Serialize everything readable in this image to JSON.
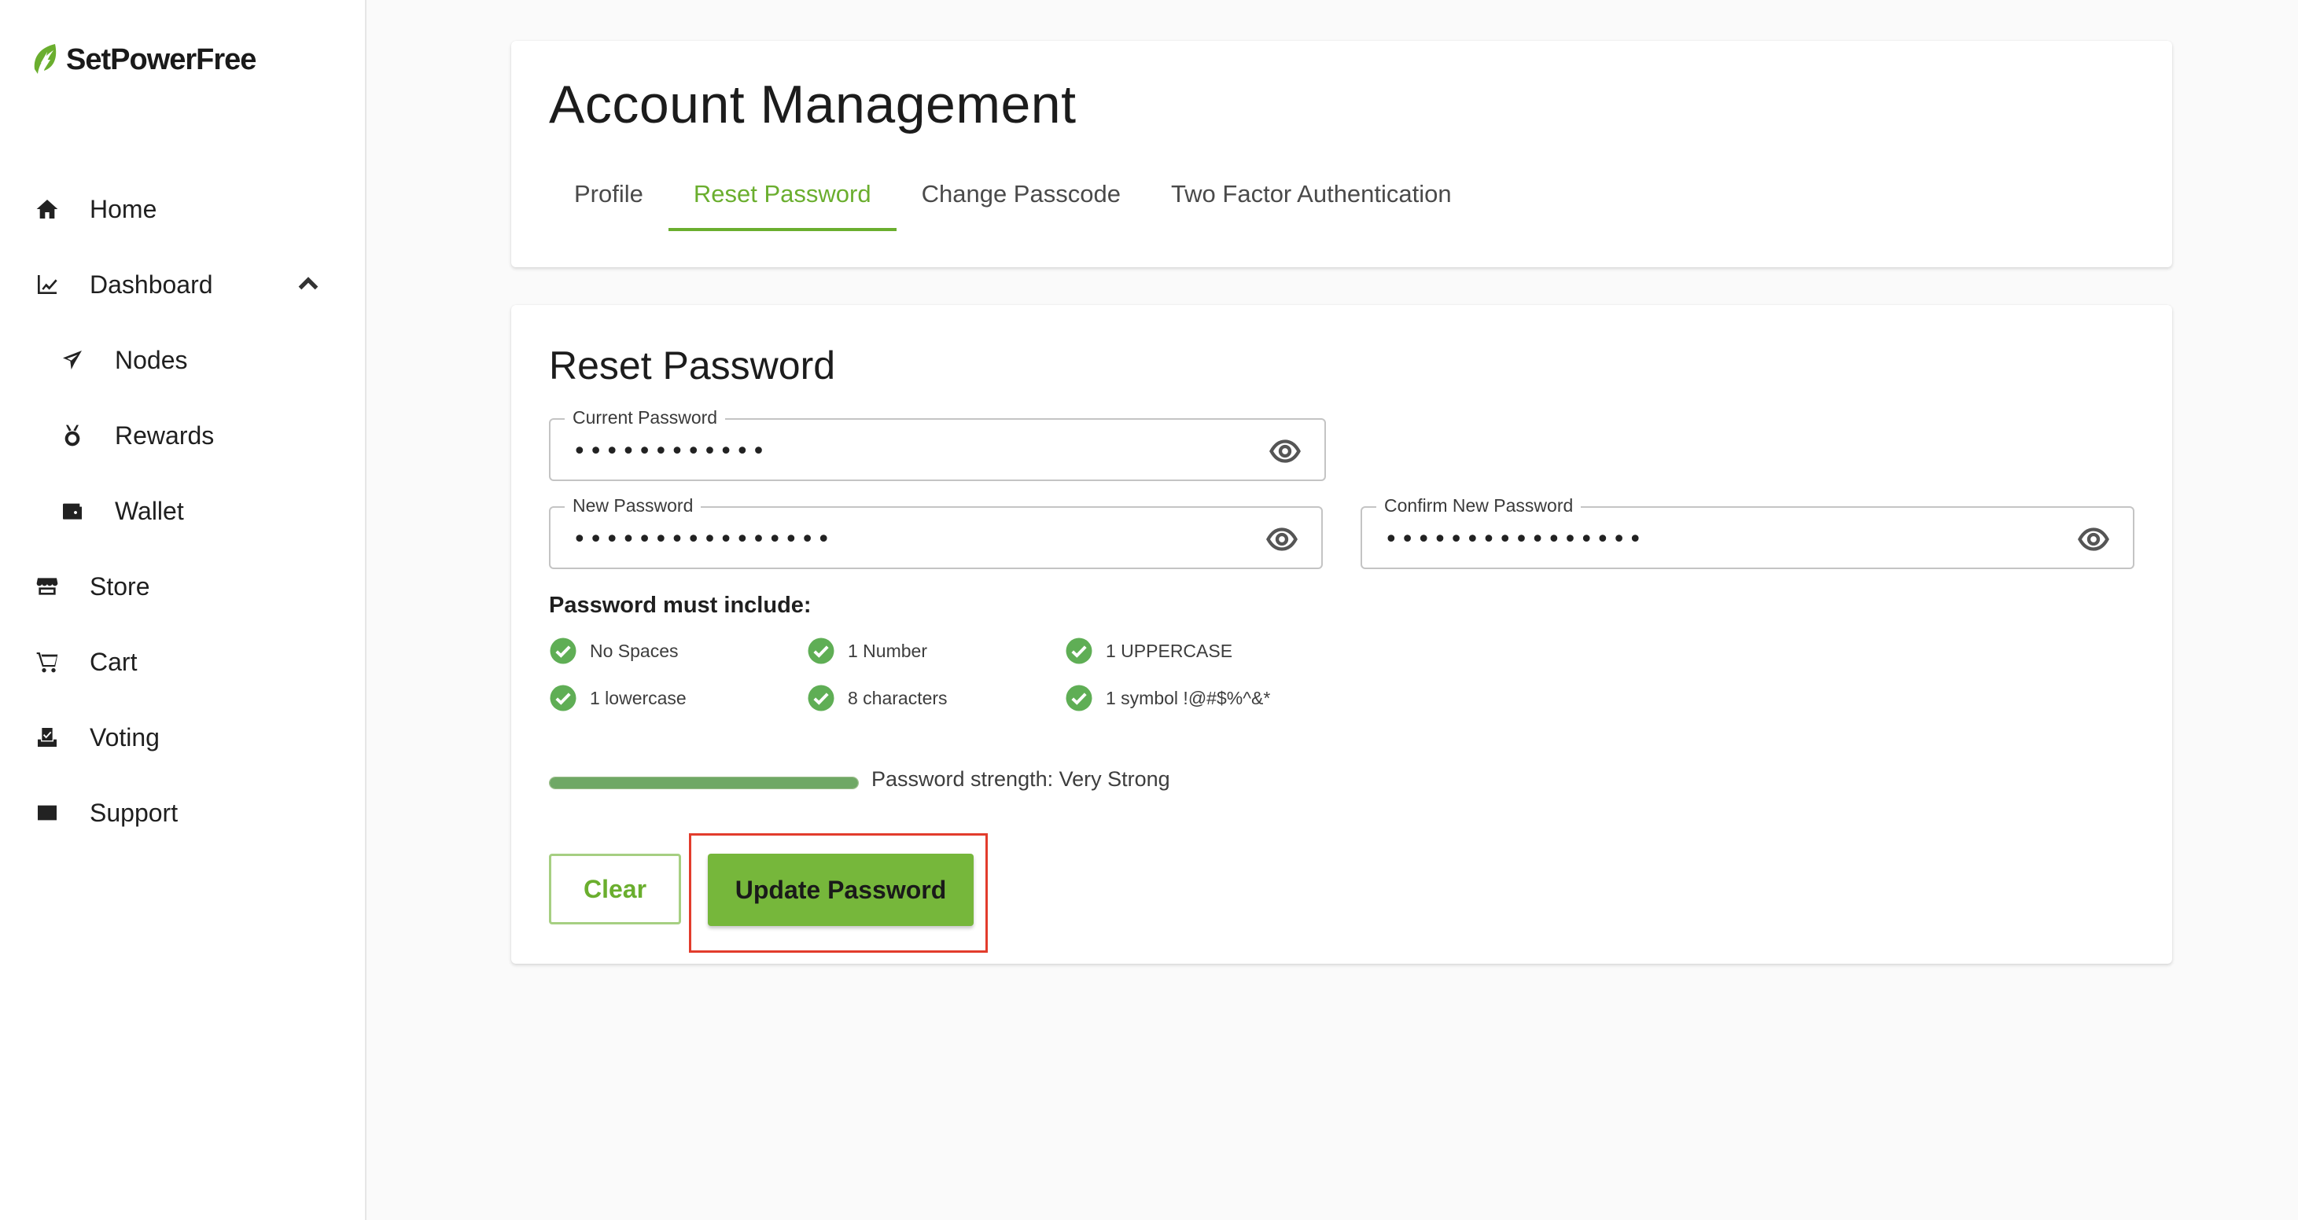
{
  "brand": {
    "name": "SetPowerFree",
    "accent": "#6aae2e"
  },
  "sidebar": {
    "items": [
      {
        "label": "Home",
        "icon": "home-icon"
      },
      {
        "label": "Dashboard",
        "icon": "chart-line-icon",
        "expanded": true
      },
      {
        "label": "Nodes",
        "icon": "nodes-icon",
        "sub": true
      },
      {
        "label": "Rewards",
        "icon": "medal-icon",
        "sub": true
      },
      {
        "label": "Wallet",
        "icon": "wallet-icon",
        "sub": true
      },
      {
        "label": "Store",
        "icon": "store-icon"
      },
      {
        "label": "Cart",
        "icon": "cart-icon"
      },
      {
        "label": "Voting",
        "icon": "ballot-icon"
      },
      {
        "label": "Support",
        "icon": "mail-icon"
      }
    ]
  },
  "header": {
    "title": "Account Management",
    "tabs": [
      {
        "label": "Profile",
        "active": false
      },
      {
        "label": "Reset Password",
        "active": true
      },
      {
        "label": "Change Passcode",
        "active": false
      },
      {
        "label": "Two Factor Authentication",
        "active": false
      }
    ]
  },
  "form": {
    "title": "Reset Password",
    "current_password": {
      "label": "Current Password",
      "value": "••••••••••••"
    },
    "new_password": {
      "label": "New Password",
      "value": "••••••••••••••••"
    },
    "confirm_password": {
      "label": "Confirm New Password",
      "value": "••••••••••••••••"
    },
    "requirements_title": "Password must include:",
    "requirements": [
      {
        "label": "No Spaces",
        "met": true
      },
      {
        "label": "1 Number",
        "met": true
      },
      {
        "label": "1 UPPERCASE",
        "met": true
      },
      {
        "label": "1 lowercase",
        "met": true
      },
      {
        "label": "8 characters",
        "met": true
      },
      {
        "label": "1 symbol !@#$%^&*",
        "met": true
      }
    ],
    "strength": {
      "text": "Password strength: Very Strong",
      "level": 1.0
    },
    "clear_label": "Clear",
    "update_label": "Update Password"
  }
}
